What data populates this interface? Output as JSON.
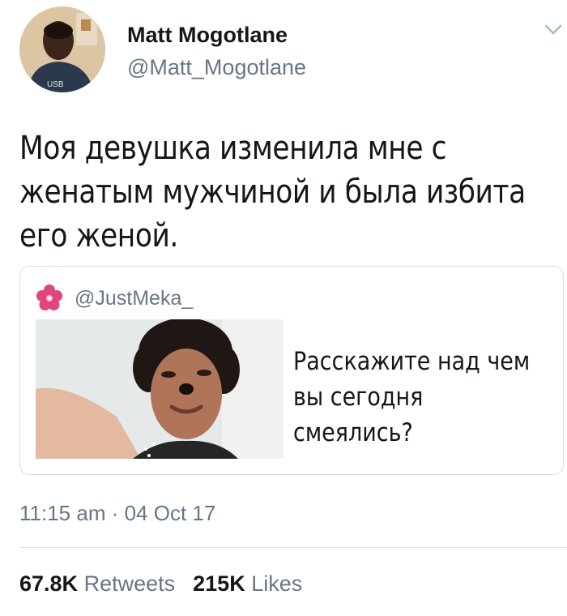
{
  "tweet": {
    "author_name": "Matt Mogotlane",
    "author_handle": "@Matt_Mogotlane",
    "avatar_shirt_text": "USB",
    "text": "Моя девушка изменила мне с женатым мужчиной и была избита его женой.",
    "timestamp": "11:15 am · 04 Oct 17"
  },
  "quoted_tweet": {
    "handle": "@JustMeka_",
    "icon": "pink-flower-icon",
    "text": "Расскажите над чем вы сегодня смеялись?"
  },
  "stats": {
    "retweets_count": "67.8K",
    "retweets_label": "Retweets",
    "likes_count": "215K",
    "likes_label": "Likes"
  },
  "colors": {
    "text_primary": "#14171a",
    "text_secondary": "#657786",
    "border": "#e1e8ed",
    "flower": "#e0457b"
  }
}
